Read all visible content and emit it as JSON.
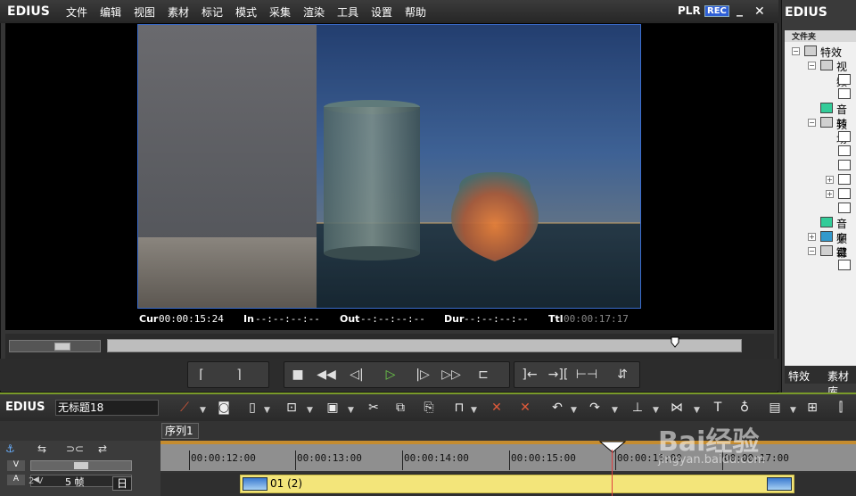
{
  "player": {
    "logo": "EDIUS",
    "menu": [
      "文件",
      "编辑",
      "视图",
      "素材",
      "标记",
      "模式",
      "采集",
      "渲染",
      "工具",
      "设置",
      "帮助"
    ],
    "plr": "PLR",
    "rec": "REC",
    "minimize": "_",
    "close": "✕",
    "timecodes": {
      "cur_label": "Cur",
      "cur": "00:00:15:24",
      "in_label": "In",
      "in": "--:--:--:--",
      "out_label": "Out",
      "out": "--:--:--:--",
      "dur_label": "Dur",
      "dur": "--:--:--:--",
      "ttl_label": "Ttl",
      "ttl": "00:00:17:17"
    }
  },
  "effects_panel": {
    "logo": "EDIUS",
    "header": "文件夹",
    "tree": [
      {
        "label": "特效"
      },
      {
        "label": "视频"
      },
      {
        "label": "音频"
      },
      {
        "label": "转场"
      },
      {
        "label": "音频"
      },
      {
        "label": "字幕"
      },
      {
        "label": "键"
      }
    ],
    "tabs": [
      "特效",
      "素材库"
    ]
  },
  "timeline": {
    "logo": "EDIUS",
    "project_name": "无标题18",
    "sequence_tab": "序列1",
    "ruler": [
      "00:00:12:00",
      "00:00:13:00",
      "00:00:14:00",
      "00:00:15:00",
      "00:00:16:00",
      "00:00:17:00"
    ],
    "fps_label": "5 帧",
    "track_name": "2 V",
    "track_badge": "日",
    "clip_label": "01 (2)"
  },
  "watermark": {
    "brand": "Bai经验",
    "url": "jingyan.baidu.com"
  },
  "colors": {
    "accent": "#3a6ccc",
    "clip": "#f3e57a",
    "ruler_bar": "#c58c2f",
    "timeline_border": "#7a9b2a"
  }
}
